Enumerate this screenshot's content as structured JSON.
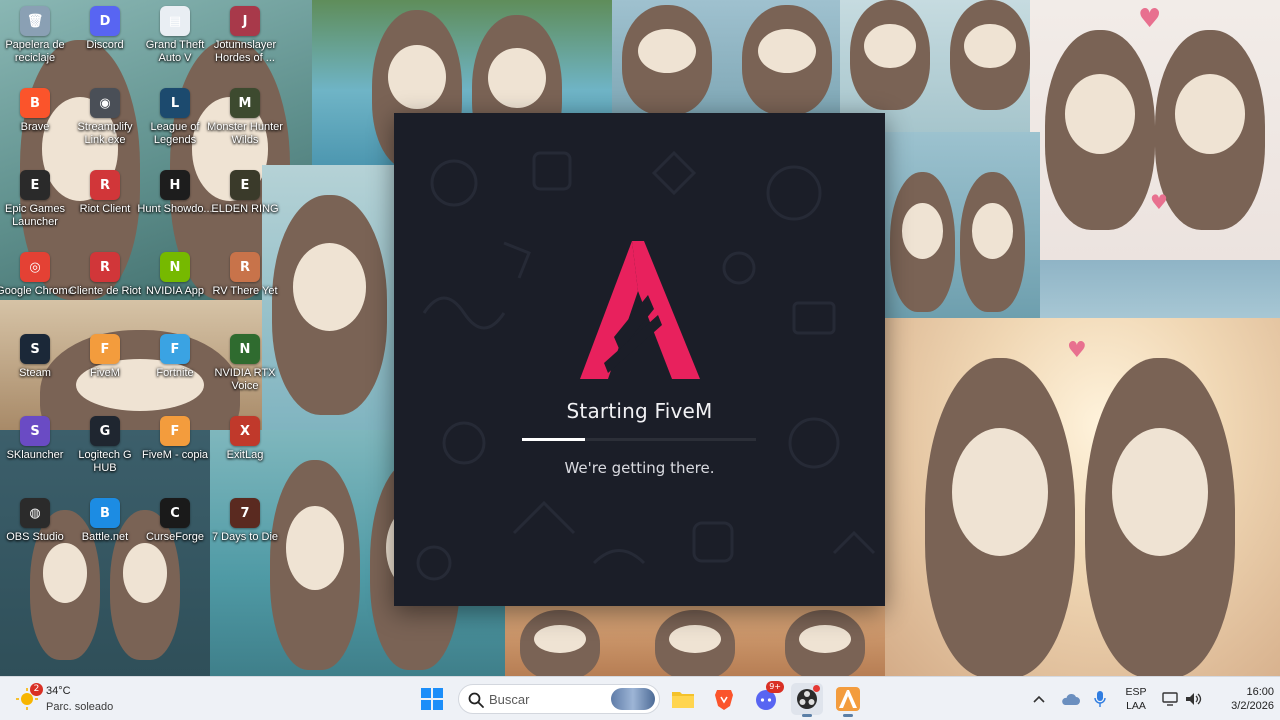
{
  "desktop": {
    "icons": [
      {
        "label": "Papelera de reciclaje",
        "glyph": "🗑",
        "color": "#8aa0b4",
        "icon": "recycle-bin-icon",
        "name": "desktop-icon-recycle-bin"
      },
      {
        "label": "Discord",
        "glyph": "D",
        "color": "#5865f2",
        "icon": "discord-icon",
        "name": "desktop-icon-discord"
      },
      {
        "label": "Grand Theft Auto V",
        "glyph": "▤",
        "color": "#e9eef3",
        "icon": "file-icon",
        "name": "desktop-icon-gta-v"
      },
      {
        "label": "Jotunnslayer Hordes of ...",
        "glyph": "J",
        "color": "#a8394a",
        "icon": "jotunnslayer-icon",
        "name": "desktop-icon-jotunnslayer"
      },
      {
        "label": "Brave",
        "glyph": "B",
        "color": "#fb542b",
        "icon": "brave-icon",
        "name": "desktop-icon-brave"
      },
      {
        "label": "Streamplify Link.exe",
        "glyph": "◉",
        "color": "#4a4f57",
        "icon": "streamplify-icon",
        "name": "desktop-icon-streamplify"
      },
      {
        "label": "League of Legends",
        "glyph": "L",
        "color": "#1c4a6e",
        "icon": "league-icon",
        "name": "desktop-icon-league"
      },
      {
        "label": "Monster Hunter Wilds",
        "glyph": "M",
        "color": "#3d4a2f",
        "icon": "monster-hunter-icon",
        "name": "desktop-icon-monster-hunter"
      },
      {
        "label": "Epic Games Launcher",
        "glyph": "E",
        "color": "#2a2a2a",
        "icon": "epic-games-icon",
        "name": "desktop-icon-epic-games"
      },
      {
        "label": "Riot Client",
        "glyph": "R",
        "color": "#d13639",
        "icon": "riot-client-icon",
        "name": "desktop-icon-riot-client"
      },
      {
        "label": "Hunt Showdo...",
        "glyph": "H",
        "color": "#1d1d1d",
        "icon": "hunt-showdown-icon",
        "name": "desktop-icon-hunt"
      },
      {
        "label": "ELDEN RING",
        "glyph": "E",
        "color": "#3a3a2a",
        "icon": "elden-ring-icon",
        "name": "desktop-icon-elden-ring"
      },
      {
        "label": "Google Chrome",
        "glyph": "◎",
        "color": "#e44134",
        "icon": "chrome-icon",
        "name": "desktop-icon-chrome"
      },
      {
        "label": "Cliente de Riot",
        "glyph": "R",
        "color": "#d13639",
        "icon": "riot-client-icon",
        "name": "desktop-icon-cliente-riot"
      },
      {
        "label": "NVIDIA App",
        "glyph": "N",
        "color": "#76b900",
        "icon": "nvidia-icon",
        "name": "desktop-icon-nvidia-app"
      },
      {
        "label": "RV There Yet",
        "glyph": "R",
        "color": "#c8734a",
        "icon": "rv-there-yet-icon",
        "name": "desktop-icon-rv-there-yet"
      },
      {
        "label": "Steam",
        "glyph": "S",
        "color": "#1b2838",
        "icon": "steam-icon",
        "name": "desktop-icon-steam"
      },
      {
        "label": "FiveM",
        "glyph": "F",
        "color": "#f39c3d",
        "icon": "fivem-icon",
        "name": "desktop-icon-fivem"
      },
      {
        "label": "Fortnite",
        "glyph": "F",
        "color": "#3aa3e3",
        "icon": "fortnite-icon",
        "name": "desktop-icon-fortnite"
      },
      {
        "label": "NVIDIA RTX Voice",
        "glyph": "N",
        "color": "#2f6b2f",
        "icon": "nvidia-rtx-voice-icon",
        "name": "desktop-icon-rtx-voice"
      },
      {
        "label": "SKlauncher",
        "glyph": "S",
        "color": "#6a4bc4",
        "icon": "sklauncher-icon",
        "name": "desktop-icon-sklauncher"
      },
      {
        "label": "Logitech G HUB",
        "glyph": "G",
        "color": "#1f2630",
        "icon": "logitech-icon",
        "name": "desktop-icon-logitech"
      },
      {
        "label": "FiveM - copia",
        "glyph": "F",
        "color": "#f39c3d",
        "icon": "fivem-icon",
        "name": "desktop-icon-fivem-copia"
      },
      {
        "label": "ExitLag",
        "glyph": "X",
        "color": "#c0392b",
        "icon": "exitlag-icon",
        "name": "desktop-icon-exitlag"
      },
      {
        "label": "OBS Studio",
        "glyph": "◍",
        "color": "#2b2b2b",
        "icon": "obs-icon",
        "name": "desktop-icon-obs"
      },
      {
        "label": "Battle.net",
        "glyph": "B",
        "color": "#1c8ce3",
        "icon": "battlenet-icon",
        "name": "desktop-icon-battlenet"
      },
      {
        "label": "CurseForge",
        "glyph": "C",
        "color": "#1a1a1a",
        "icon": "curseforge-icon",
        "name": "desktop-icon-curseforge"
      },
      {
        "label": "7 Days to Die",
        "glyph": "7",
        "color": "#5a2a20",
        "icon": "seven-days-icon",
        "name": "desktop-icon-7days"
      }
    ]
  },
  "launcher": {
    "title": "Starting FiveM",
    "subtitle": "We're getting there.",
    "progress": 0.27,
    "accent": "#e8215d",
    "background": "#1b1e28"
  },
  "taskbar": {
    "weather": {
      "temp": "34°C",
      "desc": "Parc. soleado",
      "badge": "2"
    },
    "search": {
      "placeholder": "Buscar"
    },
    "apps": [
      {
        "name": "start-button",
        "icon": "windows-start-icon"
      },
      {
        "name": "taskbar-file-explorer",
        "icon": "folder-icon"
      },
      {
        "name": "taskbar-brave",
        "icon": "brave-icon"
      },
      {
        "name": "taskbar-discord",
        "icon": "discord-icon",
        "badge": "9+"
      },
      {
        "name": "taskbar-obs",
        "icon": "obs-icon"
      },
      {
        "name": "taskbar-fivem",
        "icon": "fivem-icon"
      }
    ],
    "discord_badge": "9+",
    "tray": {
      "language": "ESP",
      "layout": "LAA",
      "time": "16:00",
      "date": "3/2/2026"
    }
  }
}
